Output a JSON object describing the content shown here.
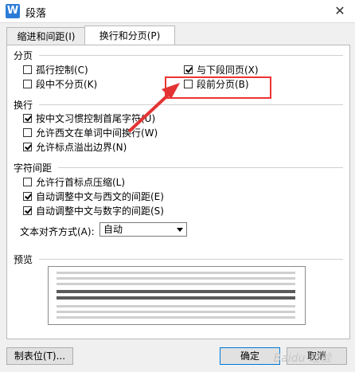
{
  "window": {
    "title": "段落",
    "app_icon_letter": "W",
    "close_symbol": "✕"
  },
  "tabs": [
    {
      "label": "缩进和间距(I)",
      "active": false
    },
    {
      "label": "换行和分页(P)",
      "active": true
    }
  ],
  "sections": {
    "pagination": {
      "label": "分页",
      "options": [
        {
          "label": "孤行控制(C)",
          "checked": false
        },
        {
          "label": "与下段同页(X)",
          "checked": true
        },
        {
          "label": "段中不分页(K)",
          "checked": false
        },
        {
          "label": "段前分页(B)",
          "checked": false
        }
      ]
    },
    "line_breaking": {
      "label": "换行",
      "options": [
        {
          "label": "按中文习惯控制首尾字符(U)",
          "checked": true
        },
        {
          "label": "允许西文在单词中间换行(W)",
          "checked": false
        },
        {
          "label": "允许标点溢出边界(N)",
          "checked": true
        }
      ]
    },
    "char_spacing": {
      "label": "字符间距",
      "options": [
        {
          "label": "允许行首标点压缩(L)",
          "checked": false
        },
        {
          "label": "自动调整中文与西文的间距(E)",
          "checked": true
        },
        {
          "label": "自动调整中文与数字的间距(S)",
          "checked": true
        }
      ],
      "alignment_label": "文本对齐方式(A):",
      "alignment_value": "自动"
    },
    "preview": {
      "label": "预览"
    }
  },
  "buttons": {
    "tabs": "制表位(T)...",
    "ok": "确定",
    "cancel": "取消"
  },
  "watermark": "Baidu 经验",
  "colors": {
    "highlight": "#e33333",
    "accent": "#2b7bd6"
  }
}
